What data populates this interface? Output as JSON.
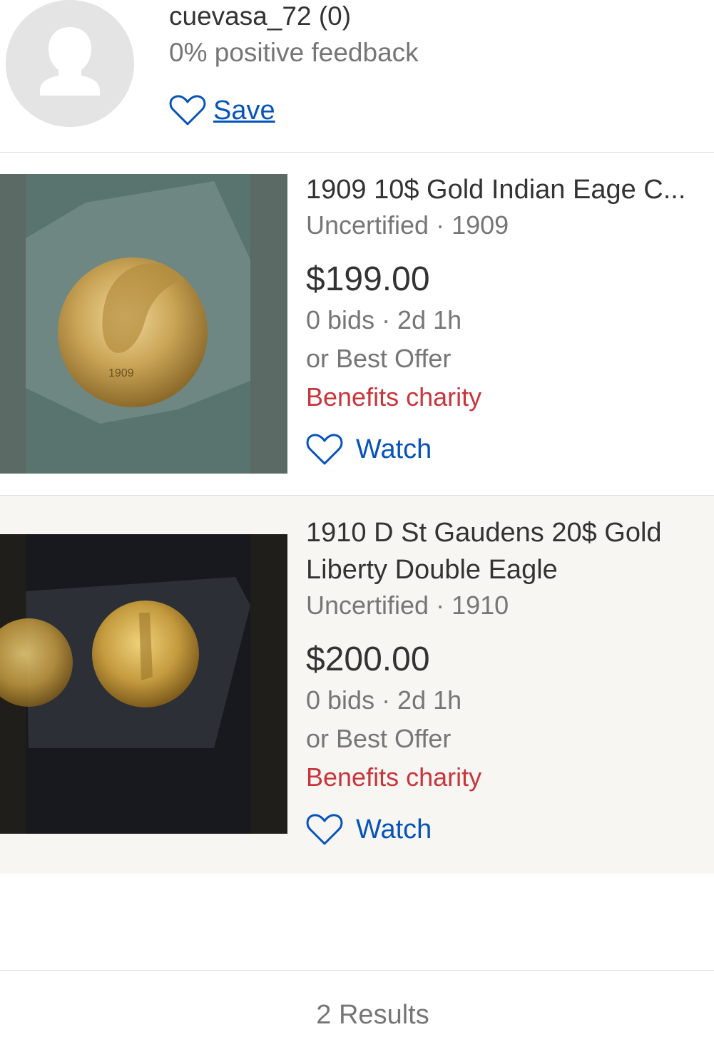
{
  "seller": {
    "name": "cuevasa_72 (0)",
    "feedback": "0% positive feedback",
    "save_label": "Save"
  },
  "items": [
    {
      "title": "1909 10$ Gold Indian Eage C...",
      "meta": "Uncertified · 1909",
      "price": "$199.00",
      "bids": "0 bids · 2d 1h",
      "offer": "or Best Offer",
      "charity": "Benefits charity",
      "watch_label": "Watch",
      "image_text": "1909"
    },
    {
      "title": "1910 D St Gaudens 20$ Gold Liberty Double Eagle",
      "meta": "Uncertified · 1910",
      "price": "$200.00",
      "bids": "0 bids · 2d 1h",
      "offer": "or Best Offer",
      "charity": "Benefits charity",
      "watch_label": "Watch"
    }
  ],
  "results": "2 Results",
  "colors": {
    "link_blue": "#0654ba",
    "charity_red": "#c8353b",
    "muted_gray": "#767676"
  }
}
